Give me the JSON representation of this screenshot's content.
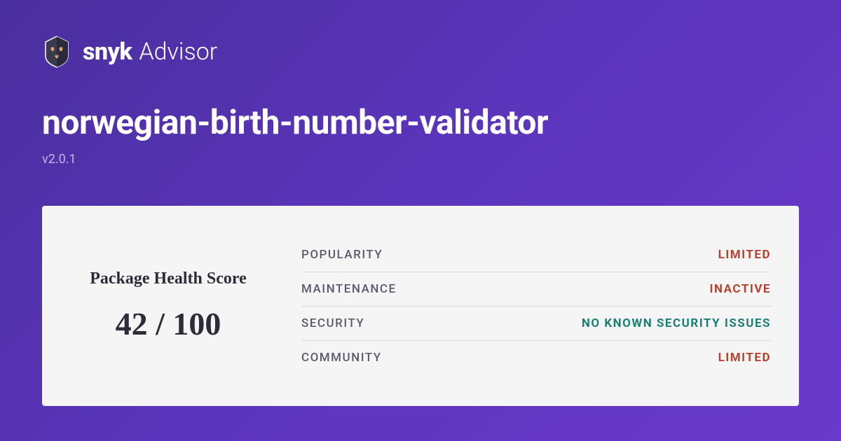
{
  "brand": {
    "name_bold": "snyk",
    "name_light": "Advisor"
  },
  "package": {
    "name": "norwegian-birth-number-validator",
    "version": "v2.0.1"
  },
  "score": {
    "label": "Package Health Score",
    "value": "42 / 100"
  },
  "metrics": [
    {
      "label": "POPULARITY",
      "value": "LIMITED",
      "status": "bad"
    },
    {
      "label": "MAINTENANCE",
      "value": "INACTIVE",
      "status": "bad"
    },
    {
      "label": "SECURITY",
      "value": "NO KNOWN SECURITY ISSUES",
      "status": "good"
    },
    {
      "label": "COMMUNITY",
      "value": "LIMITED",
      "status": "bad"
    }
  ]
}
